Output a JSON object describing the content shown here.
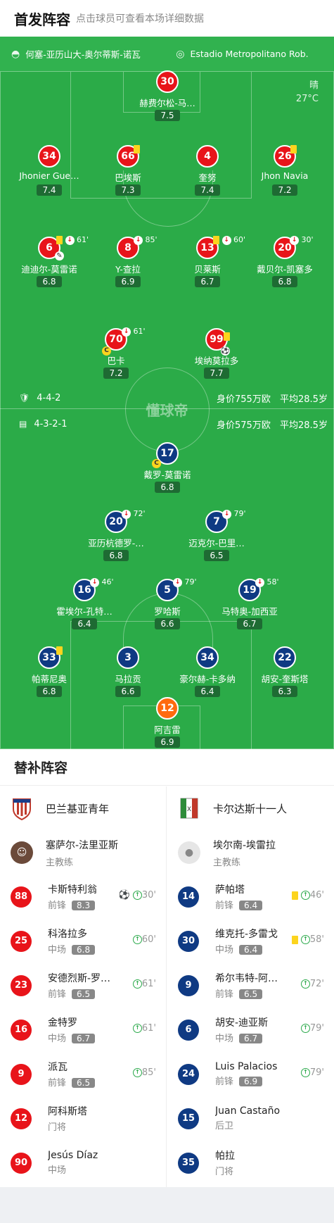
{
  "header": {
    "title": "首发阵容",
    "subtitle": "点击球员可查看本场详细数据"
  },
  "info": {
    "referee": "何塞-亚历山大-奥尔蒂斯-诺瓦",
    "stadium": "Estadio Metropolitano Rob...",
    "weather": "晴",
    "temperature": "27°C"
  },
  "watermark": "懂球帝",
  "home": {
    "formation": "4-4-2",
    "value": "身价755万欧",
    "age": "平均28.5岁",
    "players": [
      {
        "num": "30",
        "name": "赫费尔松-马…",
        "rating": "7.5"
      },
      {
        "num": "34",
        "name": "Jhonier Gue…",
        "rating": "7.4"
      },
      {
        "num": "66",
        "name": "巴埃斯",
        "rating": "7.3"
      },
      {
        "num": "4",
        "name": "奎努",
        "rating": "7.4"
      },
      {
        "num": "26",
        "name": "Jhon Navia",
        "rating": "7.2"
      },
      {
        "num": "6",
        "name": "迪迪尔-莫雷诺",
        "rating": "6.8",
        "sub": "61'"
      },
      {
        "num": "8",
        "name": "Y-查拉",
        "rating": "6.9",
        "sub": "85'"
      },
      {
        "num": "13",
        "name": "贝莱斯",
        "rating": "6.7",
        "sub": "60'"
      },
      {
        "num": "20",
        "name": "戴贝尔-凯塞多",
        "rating": "6.8",
        "sub": "30'"
      },
      {
        "num": "70",
        "name": "巴卡",
        "rating": "7.2",
        "sub": "61'"
      },
      {
        "num": "99",
        "name": "埃纳莫拉多",
        "rating": "7.7"
      }
    ]
  },
  "away": {
    "formation": "4-3-2-1",
    "value": "身价575万欧",
    "age": "平均28.5岁",
    "players": [
      {
        "num": "17",
        "name": "戴罗-莫雷诺",
        "rating": "6.8"
      },
      {
        "num": "20",
        "name": "亚历杭德罗-…",
        "rating": "6.8",
        "sub": "72'"
      },
      {
        "num": "7",
        "name": "迈克尔-巴里…",
        "rating": "6.5",
        "sub": "79'"
      },
      {
        "num": "16",
        "name": "霍埃尔-孔特…",
        "rating": "6.4",
        "sub": "46'"
      },
      {
        "num": "5",
        "name": "罗哈斯",
        "rating": "6.6",
        "sub": "79'"
      },
      {
        "num": "19",
        "name": "马特奥-加西亚",
        "rating": "6.7",
        "sub": "58'"
      },
      {
        "num": "33",
        "name": "帕蒂尼奥",
        "rating": "6.8"
      },
      {
        "num": "3",
        "name": "马拉贡",
        "rating": "6.6"
      },
      {
        "num": "34",
        "name": "豪尔赫-卡多纳",
        "rating": "6.4"
      },
      {
        "num": "22",
        "name": "胡安-奎斯塔",
        "rating": "6.3"
      },
      {
        "num": "12",
        "name": "阿吉雷",
        "rating": "6.9"
      }
    ]
  },
  "subs": {
    "title": "替补阵容",
    "home_team": "巴兰基亚青年",
    "away_team": "卡尔达斯十一人",
    "home_coach": {
      "name": "塞萨尔-法里亚斯",
      "role": "主教练"
    },
    "away_coach": {
      "name": "埃尔南-埃雷拉",
      "role": "主教练"
    },
    "home": [
      {
        "num": "88",
        "name": "卡斯特利翁",
        "pos": "前锋",
        "rating": "8.3",
        "min": "30'"
      },
      {
        "num": "25",
        "name": "科洛拉多",
        "pos": "中场",
        "rating": "6.8",
        "min": "60'"
      },
      {
        "num": "23",
        "name": "安德烈斯-罗…",
        "pos": "前锋",
        "rating": "6.5",
        "min": "61'"
      },
      {
        "num": "16",
        "name": "金特罗",
        "pos": "中场",
        "rating": "6.7",
        "min": "61'"
      },
      {
        "num": "9",
        "name": "派瓦",
        "pos": "前锋",
        "rating": "6.5",
        "min": "85'"
      },
      {
        "num": "12",
        "name": "阿科斯塔",
        "pos": "门将"
      },
      {
        "num": "90",
        "name": "Jesús Díaz",
        "pos": "中场"
      }
    ],
    "away": [
      {
        "num": "14",
        "name": "萨帕塔",
        "pos": "前锋",
        "rating": "6.4",
        "min": "46'"
      },
      {
        "num": "30",
        "name": "维克托-多雷戈",
        "pos": "中场",
        "rating": "6.4",
        "min": "58'"
      },
      {
        "num": "9",
        "name": "希尔韦特-阿…",
        "pos": "前锋",
        "rating": "6.5",
        "min": "72'"
      },
      {
        "num": "6",
        "name": "胡安-迪亚斯",
        "pos": "中场",
        "rating": "6.7",
        "min": "79'"
      },
      {
        "num": "24",
        "name": "Luis Palacios",
        "pos": "前锋",
        "rating": "6.9",
        "min": "79'"
      },
      {
        "num": "15",
        "name": "Juan Castaño",
        "pos": "后卫"
      },
      {
        "num": "35",
        "name": "帕拉",
        "pos": "门将"
      }
    ]
  }
}
